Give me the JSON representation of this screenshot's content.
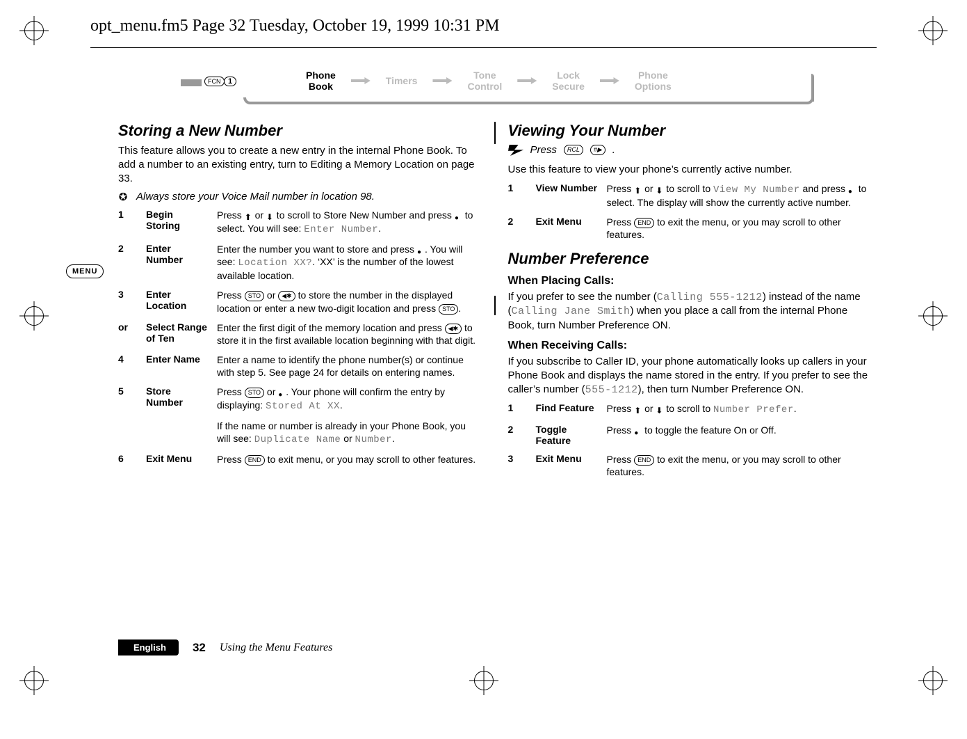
{
  "header_line": "opt_menu.fm5  Page 32  Tuesday, October 19, 1999  10:31 PM",
  "nav": {
    "fcn": "FCN",
    "one": "1",
    "items": [
      {
        "line1": "Phone",
        "line2": "Book",
        "active": true
      },
      {
        "line1": "Timers",
        "line2": "",
        "active": false
      },
      {
        "line1": "Tone",
        "line2": "Control",
        "active": false
      },
      {
        "line1": "Lock",
        "line2": "Secure",
        "active": false
      },
      {
        "line1": "Phone",
        "line2": "Options",
        "active": false
      }
    ]
  },
  "menu_tab": "MENU",
  "left": {
    "title": "Storing a New Number",
    "intro": "This feature allows you to create a new entry in the internal Phone Book. To add a number to an existing entry, turn to Editing a Memory Location on page 33.",
    "tip": "Always store your Voice Mail number in location 98.",
    "steps": [
      {
        "n": "1",
        "title": "Begin Storing",
        "desc_parts": [
          "Press ",
          "_SCROLLUP_",
          " or ",
          "_SCROLLDN_",
          " to scroll to Store New Number and press ",
          "_SEL_",
          " to select. You will see: ",
          "_LCD_Enter Number",
          "."
        ]
      },
      {
        "n": "2",
        "title": "Enter Number",
        "desc_parts": [
          "Enter the number you want to store and press ",
          "_SEL_",
          ". You will see: ",
          "_LCD_Location XX?",
          ". ‘XX’ is the number of the lowest available location."
        ]
      },
      {
        "n": "3",
        "title": "Enter Location",
        "desc_parts": [
          "Press ",
          "_KEY_STO",
          " or ",
          "_KEY_◀✱",
          " to store the number in the displayed location or enter a new two-digit location and press ",
          "_KEY_STO",
          "."
        ]
      },
      {
        "n": "or",
        "title": "Select Range of Ten",
        "desc_parts": [
          "Enter the first digit of the memory location and press ",
          "_KEY_◀✱",
          " to store it in the first available location beginning with that digit."
        ]
      },
      {
        "n": "4",
        "title": "Enter Name",
        "desc_parts": [
          "Enter a name to identify the phone number(s) or continue with step 5. See page 24 for details on entering names."
        ]
      },
      {
        "n": "5",
        "title": "Store Number",
        "desc_parts": [
          "Press ",
          "_KEY_STO",
          " or ",
          "_SEL_",
          ". Your phone will confirm the entry by displaying: ",
          "_LCD_Stored At XX",
          "."
        ]
      },
      {
        "n": "",
        "title": "",
        "desc_parts": [
          "If the name or number is already in your Phone Book, you will see: ",
          "_LCD_Duplicate Name",
          " or ",
          "_LCD_Number",
          "."
        ]
      },
      {
        "n": "6",
        "title": "Exit Menu",
        "desc_parts": [
          "Press ",
          "_KEY_END",
          " to exit menu, or you may scroll to other features."
        ]
      }
    ]
  },
  "right": {
    "title1": "Viewing Your Number",
    "press_label": "Press",
    "press_keys": [
      "RCL",
      "#▶"
    ],
    "intro1": "Use this feature to view your phone’s currently active number.",
    "steps1": [
      {
        "n": "1",
        "title": "View Number",
        "desc_parts": [
          "Press ",
          "_SCROLLUP_",
          " or ",
          "_SCROLLDN_",
          " to scroll to ",
          "_LCD_View My Number",
          " and press ",
          "_SEL_",
          " to select. The display will show the currently active number."
        ]
      },
      {
        "n": "2",
        "title": "Exit Menu",
        "desc_parts": [
          "Press ",
          "_KEY_END",
          " to exit the menu, or you may scroll to other features."
        ]
      }
    ],
    "title2": "Number Preference",
    "sub1": "When Placing Calls:",
    "para1_parts": [
      "If you prefer to see the number (",
      "_LCD_Calling 555-1212",
      ") instead of the name (",
      "_LCD_Calling Jane Smith",
      ") when you place a call from the internal Phone Book, turn Number Preference ON."
    ],
    "sub2": "When Receiving Calls:",
    "para2_parts": [
      "If you subscribe to Caller ID, your phone automatically looks up callers in your Phone Book and displays the name stored in the entry. If you prefer to see the caller’s number (",
      "_LCD_555-1212",
      "), then turn Number Preference ON."
    ],
    "steps2": [
      {
        "n": "1",
        "title": "Find Feature",
        "desc_parts": [
          "Press ",
          "_SCROLLUP_",
          " or ",
          "_SCROLLDN_",
          " to scroll to ",
          "_LCD_Number Prefer",
          "."
        ]
      },
      {
        "n": "2",
        "title": "Toggle Feature",
        "desc_parts": [
          "Press ",
          "_SEL_",
          " to toggle the feature On or Off."
        ]
      },
      {
        "n": "3",
        "title": "Exit Menu",
        "desc_parts": [
          "Press ",
          "_KEY_END",
          " to exit the menu, or you may scroll to other features."
        ]
      }
    ]
  },
  "footer": {
    "lang": "English",
    "page": "32",
    "chapter": "Using the Menu Features"
  }
}
